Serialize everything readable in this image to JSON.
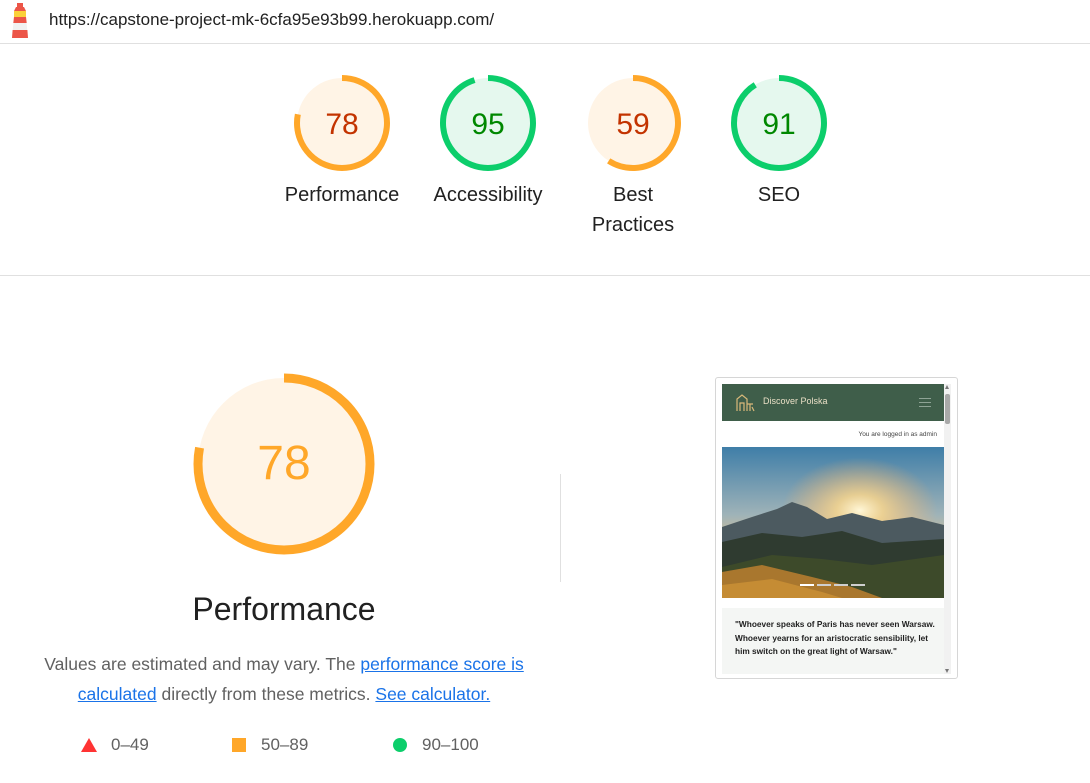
{
  "url": "https://capstone-project-mk-6cfa95e93b99.herokuapp.com/",
  "colors": {
    "average": "#ffa729",
    "average_text": "#c33300",
    "pass": "#0cce6b",
    "pass_text": "#008800",
    "fail": "#ff3333"
  },
  "scores": [
    {
      "label": "Performance",
      "value": "78",
      "status": "average"
    },
    {
      "label": "Accessibility",
      "value": "95",
      "status": "pass"
    },
    {
      "label": "Best Practices",
      "value": "59",
      "status": "average"
    },
    {
      "label": "SEO",
      "value": "91",
      "status": "pass"
    }
  ],
  "performance": {
    "score": "78",
    "title": "Performance",
    "desc_1": "Values are estimated and may vary. The ",
    "link_score": "performance score is calculated",
    "desc_2": " directly from these metrics. ",
    "link_calc": "See calculator."
  },
  "legend": [
    {
      "icon": "triangle-icon",
      "range": "0–49"
    },
    {
      "icon": "square-icon",
      "range": "50–89"
    },
    {
      "icon": "circle-icon",
      "range": "90–100"
    }
  ],
  "screenshot": {
    "brand": "Discover Polska",
    "logged_in": "You are logged in as admin",
    "quote": "\"Whoever speaks of Paris has never seen Warsaw. Whoever yearns for an aristocratic sensibility, let him switch on the great light of Warsaw.\""
  }
}
